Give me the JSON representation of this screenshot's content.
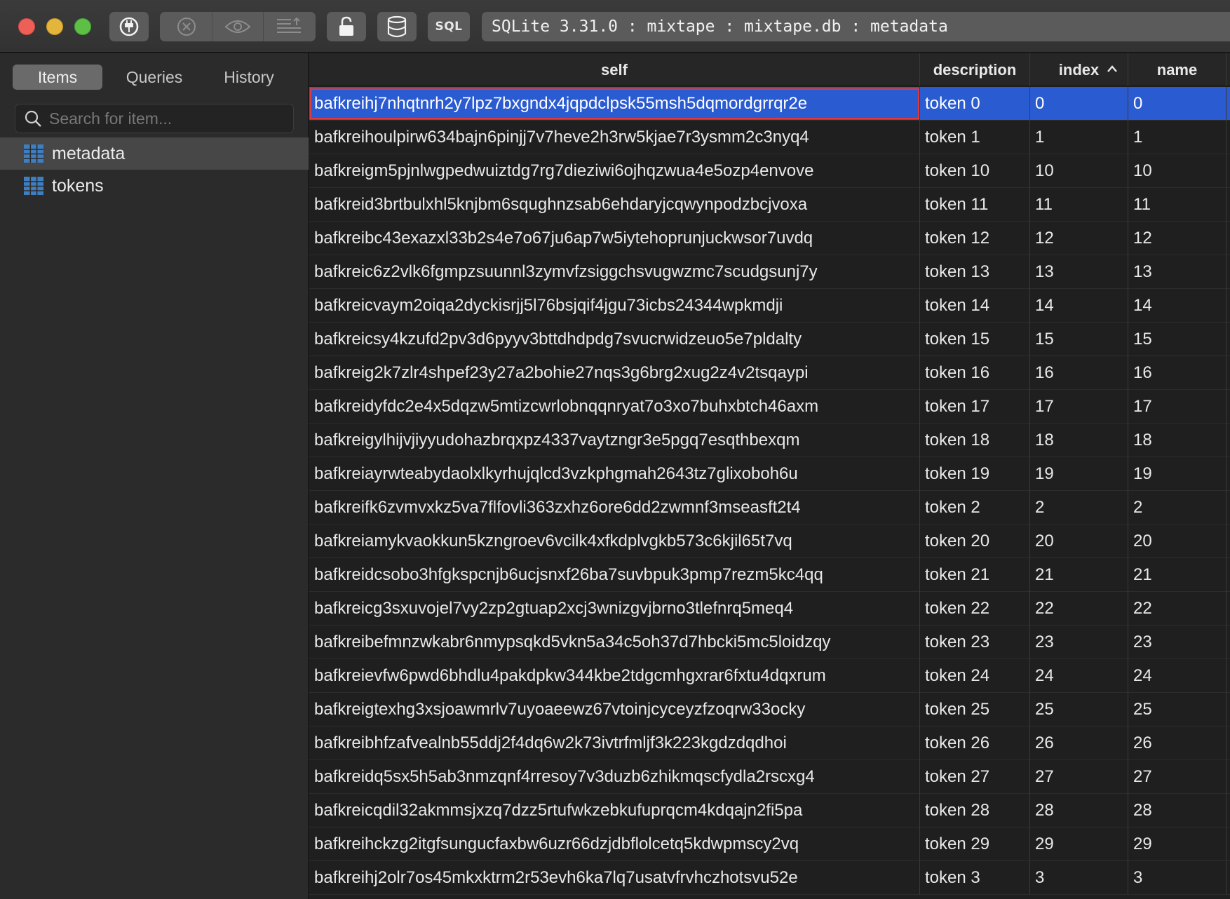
{
  "window": {
    "path": "SQLite 3.31.0 : mixtape : mixtape.db : metadata",
    "sql_button": "SQL"
  },
  "toolbar": {
    "buttons": [
      "power-icon",
      "close-circle-icon",
      "eye-icon",
      "list-export-icon",
      "lock-icon",
      "database-icon",
      "sql-button"
    ]
  },
  "sidebar": {
    "tabs": [
      {
        "label": "Items",
        "active": true
      },
      {
        "label": "Queries",
        "active": false
      },
      {
        "label": "History",
        "active": false
      }
    ],
    "search_placeholder": "Search for item...",
    "items": [
      {
        "label": "metadata",
        "selected": true
      },
      {
        "label": "tokens",
        "selected": false
      }
    ]
  },
  "table": {
    "columns": [
      "self",
      "description",
      "index",
      "name"
    ],
    "sorted_column": "index",
    "sort_direction": "ascending",
    "rows": [
      [
        "bafkreihj7nhqtnrh2y7lpz7bxgndx4jqpdclpsk55msh5dqmordgrrqr2e",
        "token 0",
        "0",
        "0"
      ],
      [
        "bafkreihoulpirw634bajn6pinjj7v7heve2h3rw5kjae7r3ysmm2c3nyq4",
        "token 1",
        "1",
        "1"
      ],
      [
        "bafkreigm5pjnlwgpedwuiztdg7rg7dieziwi6ojhqzwua4e5ozp4envove",
        "token 10",
        "10",
        "10"
      ],
      [
        "bafkreid3brtbulxhl5knjbm6squghnzsab6ehdaryjcqwynpodzbcjvoxa",
        "token 11",
        "11",
        "11"
      ],
      [
        "bafkreibc43exazxl33b2s4e7o67ju6ap7w5iytehoprunjuckwsor7uvdq",
        "token 12",
        "12",
        "12"
      ],
      [
        "bafkreic6z2vlk6fgmpzsuunnl3zymvfzsiggchsvugwzmc7scudgsunj7y",
        "token 13",
        "13",
        "13"
      ],
      [
        "bafkreicvaym2oiqa2dyckisrjj5l76bsjqif4jgu73icbs24344wpkmdji",
        "token 14",
        "14",
        "14"
      ],
      [
        "bafkreicsy4kzufd2pv3d6pyyv3bttdhdpdg7svucrwidzeuo5e7pldalty",
        "token 15",
        "15",
        "15"
      ],
      [
        "bafkreig2k7zlr4shpef23y27a2bohie27nqs3g6brg2xug2z4v2tsqaypi",
        "token 16",
        "16",
        "16"
      ],
      [
        "bafkreidyfdc2e4x5dqzw5mtizcwrlobnqqnryat7o3xo7buhxbtch46axm",
        "token 17",
        "17",
        "17"
      ],
      [
        "bafkreigylhijvjiyyudohazbrqxpz4337vaytzngr3e5pgq7esqthbexqm",
        "token 18",
        "18",
        "18"
      ],
      [
        "bafkreiayrwteabydaolxlkyrhujqlcd3vzkphgmah2643tz7glixoboh6u",
        "token 19",
        "19",
        "19"
      ],
      [
        "bafkreifk6zvmvxkz5va7flfovli363zxhz6ore6dd2zwmnf3mseasft2t4",
        "token 2",
        "2",
        "2"
      ],
      [
        "bafkreiamykvaokkun5kzngroev6vcilk4xfkdplvgkb573c6kjil65t7vq",
        "token 20",
        "20",
        "20"
      ],
      [
        "bafkreidcsobo3hfgkspcnjb6ucjsnxf26ba7suvbpuk3pmp7rezm5kc4qq",
        "token 21",
        "21",
        "21"
      ],
      [
        "bafkreicg3sxuvojel7vy2zp2gtuap2xcj3wnizgvjbrno3tlefnrq5meq4",
        "token 22",
        "22",
        "22"
      ],
      [
        "bafkreibefmnzwkabr6nmypsqkd5vkn5a34c5oh37d7hbcki5mc5loidzqy",
        "token 23",
        "23",
        "23"
      ],
      [
        "bafkreievfw6pwd6bhdlu4pakdpkw344kbe2tdgcmhgxrar6fxtu4dqxrum",
        "token 24",
        "24",
        "24"
      ],
      [
        "bafkreigtexhg3xsjoawmrlv7uyoaeewz67vtoinjcyceyzfzoqrw33ocky",
        "token 25",
        "25",
        "25"
      ],
      [
        "bafkreibhfzafvealnb55ddj2f4dq6w2k73ivtrfmljf3k223kgdzdqdhoi",
        "token 26",
        "26",
        "26"
      ],
      [
        "bafkreidq5sx5h5ab3nmzqnf4rresoy7v3duzb6zhikmqscfydla2rscxg4",
        "token 27",
        "27",
        "27"
      ],
      [
        "bafkreicqdil32akmmsjxzq7dzz5rtufwkzebkufuprqcm4kdqajn2fi5pa",
        "token 28",
        "28",
        "28"
      ],
      [
        "bafkreihckzg2itgfsungucfaxbw6uzr66dzjdbflolcetq5kdwpmscy2vq",
        "token 29",
        "29",
        "29"
      ],
      [
        "bafkreihj2olr7os45mkxktrm2r53evh6ka7lq7usatvfrvhczhotsvu52e",
        "token 3",
        "3",
        "3"
      ]
    ]
  },
  "colors": {
    "selection": "#2b5bd1",
    "focus_border": "#e03b3b",
    "close": "#ed5f57",
    "minimize": "#e3b53b",
    "zoom": "#5dc044"
  }
}
